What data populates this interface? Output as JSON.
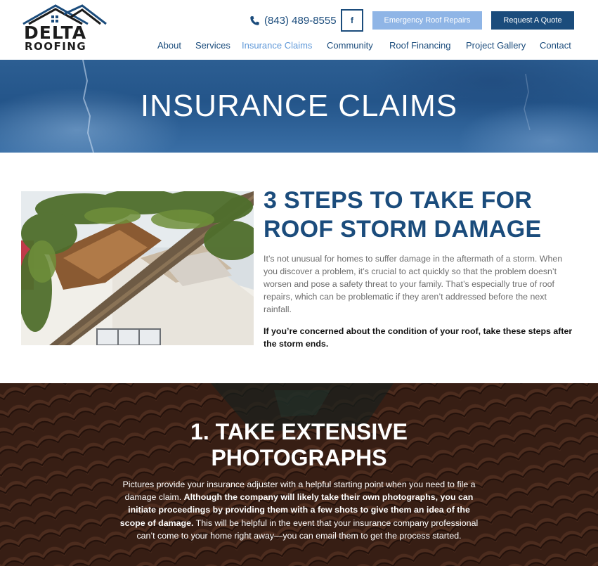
{
  "header": {
    "logo": {
      "line1": "DELTA",
      "line2": "ROOFING"
    },
    "phone": "(843) 489-8555",
    "facebook_label": "f",
    "emergency_button": "Emergency Roof Repairs",
    "quote_button": "Request A Quote",
    "nav": [
      {
        "label": "About",
        "active": false
      },
      {
        "label": "Services",
        "active": false
      },
      {
        "label": "Insurance Claims",
        "active": true
      },
      {
        "label": "Community",
        "active": false
      },
      {
        "label": "Roof Financing",
        "active": false
      },
      {
        "label": "Project Gallery",
        "active": false
      },
      {
        "label": "Contact",
        "active": false
      }
    ]
  },
  "hero": {
    "title": "INSURANCE CLAIMS"
  },
  "intro": {
    "heading_line1": "3 STEPS TO TAKE FOR",
    "heading_line2": "ROOF STORM DAMAGE",
    "paragraph": "It’s not unusual for homes to suffer damage in the aftermath of a storm. When you discover a problem, it’s crucial to act quickly so that the problem doesn’t worsen and pose a safety threat to your family. That’s especially true of roof repairs, which can be problematic if they aren’t addressed before the next rainfall.",
    "bold_text": "If you’re concerned about the condition of your roof, take these steps after the storm ends."
  },
  "step1": {
    "title_line1": "1. TAKE EXTENSIVE",
    "title_line2": "PHOTOGRAPHS",
    "text_a": "Pictures provide your insurance adjuster with a helpful starting point when you need to file a damage claim. ",
    "text_bold": "Although the company will likely take their own photographs, you can initiate proceedings by providing them with a few shots to give them an idea of the scope of damage.",
    "text_b": " This will be helpful in the event that your insurance company professional can’t come to your home right away—you can email them to get the process started."
  },
  "colors": {
    "brand_blue": "#1b4c7c",
    "light_blue": "#8fb5e6",
    "active_nav": "#5f98d8"
  },
  "icons": [
    "house-roof-icon",
    "phone-icon",
    "facebook-icon"
  ]
}
